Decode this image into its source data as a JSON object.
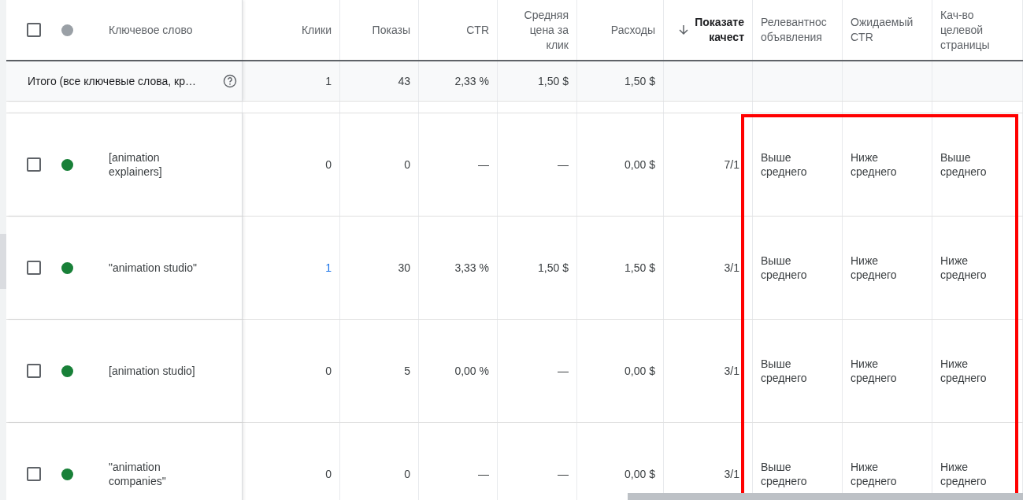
{
  "table": {
    "header": {
      "checked": false,
      "columns": [
        {
          "lines": [
            "Ключевое слово"
          ],
          "sorted": false
        },
        {
          "lines": [
            "Клики"
          ],
          "sorted": false
        },
        {
          "lines": [
            "Показы"
          ],
          "sorted": false
        },
        {
          "lines": [
            "CTR"
          ],
          "sorted": false
        },
        {
          "lines": [
            "Средняя",
            "цена за",
            "клик"
          ],
          "sorted": false
        },
        {
          "lines": [
            "Расходы"
          ],
          "sorted": false
        },
        {
          "lines": [
            "Показате",
            "качест"
          ],
          "sorted": true
        },
        {
          "lines": [
            "Релевантнос",
            "объявления"
          ],
          "sorted": false
        },
        {
          "lines": [
            "Ожидаемый",
            "CTR"
          ],
          "sorted": false
        },
        {
          "lines": [
            "Кач-во",
            "целевой",
            "страницы"
          ],
          "sorted": false
        }
      ]
    },
    "total": {
      "label": "Итого (все ключевые слова, кр…",
      "clicks": "1",
      "impressions": "43",
      "ctr": "2,33 %",
      "avg_cpc": "1,50 $",
      "cost": "1,50 $"
    },
    "rows": [
      {
        "checked": false,
        "color": "#188038",
        "keyword": "[animation explainers]",
        "clicks": "0",
        "clicks_link": false,
        "impressions": "0",
        "ctr": "—",
        "avg_cpc": "—",
        "cost": "0,00 $",
        "quality": "7/1",
        "ad_relevance": "Выше среднего",
        "expected_ctr": "Ниже среднего",
        "landing_page": "Выше среднего"
      },
      {
        "checked": false,
        "color": "#188038",
        "keyword": "\"animation studio\"",
        "clicks": "1",
        "clicks_link": true,
        "impressions": "30",
        "ctr": "3,33 %",
        "avg_cpc": "1,50 $",
        "cost": "1,50 $",
        "quality": "3/1",
        "ad_relevance": "Выше среднего",
        "expected_ctr": "Ниже среднего",
        "landing_page": "Ниже среднего"
      },
      {
        "checked": false,
        "color": "#188038",
        "keyword": "[animation studio]",
        "clicks": "0",
        "clicks_link": false,
        "impressions": "5",
        "ctr": "0,00 %",
        "avg_cpc": "—",
        "cost": "0,00 $",
        "quality": "3/1",
        "ad_relevance": "Выше среднего",
        "expected_ctr": "Ниже среднего",
        "landing_page": "Ниже среднего"
      },
      {
        "checked": false,
        "color": "#188038",
        "keyword": "\"animation companies\"",
        "clicks": "0",
        "clicks_link": false,
        "impressions": "0",
        "ctr": "—",
        "avg_cpc": "—",
        "cost": "0,00 $",
        "quality": "3/1",
        "ad_relevance": "Выше среднего",
        "expected_ctr": "Ниже среднего",
        "landing_page": "Ниже среднего"
      }
    ]
  }
}
